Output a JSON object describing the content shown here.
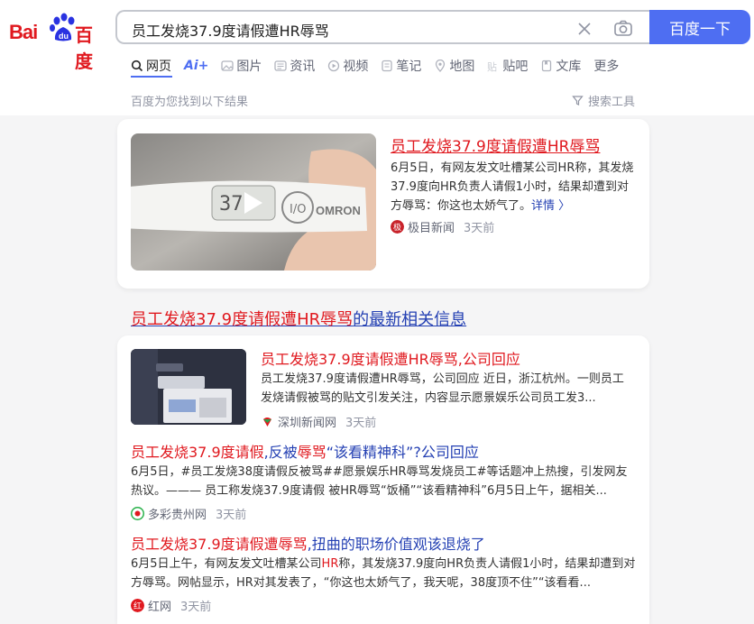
{
  "logo": {
    "bai": "Bai",
    "du": "百度"
  },
  "search": {
    "query": "员工发烧37.9度请假遭HR辱骂",
    "button": "百度一下"
  },
  "tabs": [
    {
      "label": "网页",
      "icon": "search-icon"
    },
    {
      "label": "Ai+",
      "icon": ""
    },
    {
      "label": "图片",
      "icon": "image-icon"
    },
    {
      "label": "资讯",
      "icon": "news-icon"
    },
    {
      "label": "视频",
      "icon": "video-icon"
    },
    {
      "label": "笔记",
      "icon": "note-icon"
    },
    {
      "label": "地图",
      "icon": "map-icon"
    },
    {
      "label": "贴吧",
      "icon": "tieba-icon"
    },
    {
      "label": "文库",
      "icon": "doc-icon"
    },
    {
      "label": "更多",
      "icon": ""
    }
  ],
  "found_text": "百度为您找到以下结果",
  "tools_label": "搜索工具",
  "result1": {
    "title": "员工发烧37.9度请假遭HR辱骂",
    "abstract": "6月5日，有网友发文吐槽某公司HR称，其发烧37.9度向HR负责人请假1小时，结果却遭到对方辱骂：你这也太娇气了。",
    "more": "详情 〉",
    "source": "极目新闻",
    "time": "3天前",
    "thumb_brand": "OMRON"
  },
  "section": {
    "highlight": "员工发烧37.9度请假遭HR辱骂",
    "rest": "的最新相关信息"
  },
  "news": [
    {
      "title": "员工发烧37.9度请假遭HR辱骂,公司回应",
      "abstract": "员工发烧37.9度请假遭HR辱骂，公司回应 近日，浙江杭州。一则员工发烧请假被骂的贴文引发关注，内容显示愿景娱乐公司员工发3...",
      "source": "深圳新闻网",
      "time": "3天前"
    },
    {
      "title_parts": [
        "员工发烧37.9度请假",
        ",反被",
        "辱骂",
        "“该看精神科”?公司回应"
      ],
      "abstract": "6月5日，#员工发烧38度请假反被骂##愿景娱乐HR辱骂发烧员工#等话题冲上热搜，引发网友热议。——— 员工称发烧37.9度请假 被HR辱骂“饭桶”“该看精神科”6月5日上午，据相关...",
      "source": "多彩贵州网",
      "time": "3天前"
    },
    {
      "title_parts": [
        "员工发烧37.9度请假遭辱骂",
        ",扭曲的职场价值观该退烧了"
      ],
      "abstract_parts": [
        "6月5日上午，有网友发文吐槽某公司",
        "HR",
        "称，其发烧37.9度向HR负责人请假1小时，结果却遭到对方辱骂。网帖显示，HR对其发表了，“你这也太娇气了，我天呢，38度顶不住”“该看看..."
      ],
      "source": "红网",
      "time": "3天前"
    }
  ],
  "colors": {
    "brand_red": "#e0191f",
    "link_blue": "#2440b3",
    "button_blue": "#4e6ef2"
  }
}
